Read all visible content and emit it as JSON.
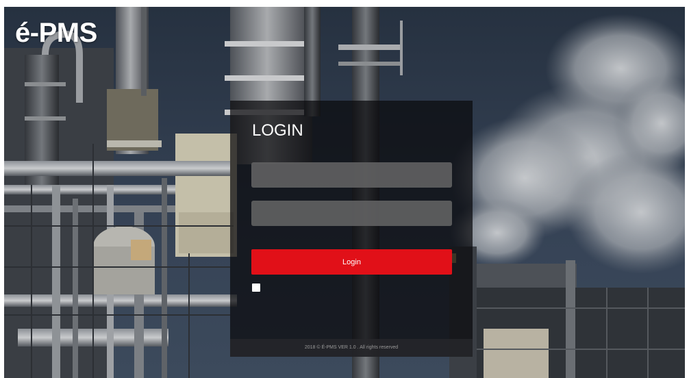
{
  "app": {
    "brand": "é-PMS"
  },
  "login_form": {
    "title": "LOGIN",
    "username": {
      "value": "",
      "placeholder": ""
    },
    "password": {
      "value": "",
      "placeholder": ""
    },
    "submit_label": "Login",
    "remember_checked": false,
    "footer": "2018 © É-PMS VER 1.0 . All rights reserved"
  },
  "colors": {
    "accent": "#e11018",
    "panel": "#0a0a0c",
    "field": "#5f5f61",
    "sky": "#2c3644"
  },
  "background": {
    "subject": "industrial-refinery-photo"
  }
}
